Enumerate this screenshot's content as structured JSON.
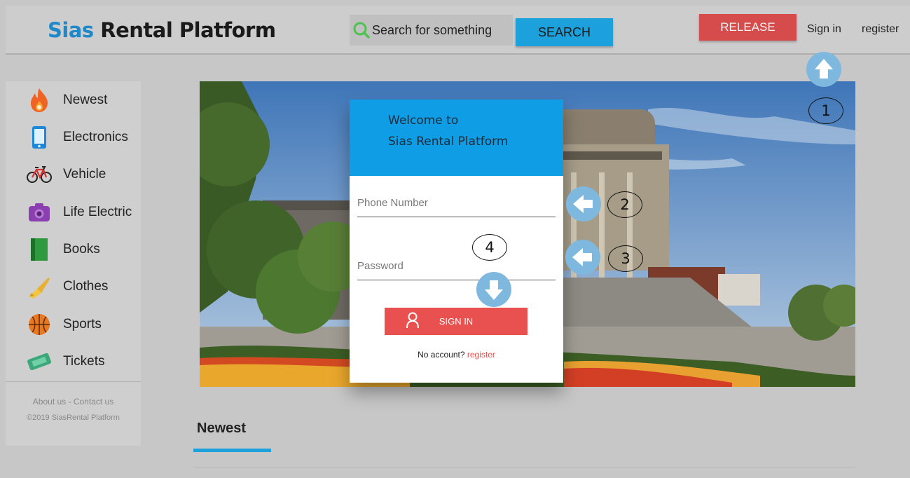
{
  "header": {
    "logo_brand": "Sias",
    "logo_rest": " Rental Platform",
    "search_placeholder": "Search for something",
    "search_button": "SEARCH",
    "release_button": "RELEASE",
    "signin_link": "Sign in",
    "register_link": "register"
  },
  "sidebar": {
    "items": [
      {
        "label": "Newest",
        "icon": "flame-icon"
      },
      {
        "label": "Electronics",
        "icon": "phone-icon"
      },
      {
        "label": "Vehicle",
        "icon": "bicycle-icon"
      },
      {
        "label": "Life Electric",
        "icon": "camera-icon"
      },
      {
        "label": "Books",
        "icon": "book-icon"
      },
      {
        "label": "Clothes",
        "icon": "clothes-brush-icon"
      },
      {
        "label": "Sports",
        "icon": "basketball-icon"
      },
      {
        "label": "Tickets",
        "icon": "ticket-icon"
      }
    ],
    "footer_links": "About us - Contact us",
    "copyright": "©2019 SiasRental Platform"
  },
  "login_modal": {
    "title_line1": "Welcome to",
    "title_line2": "Sias Rental Platform",
    "phone_placeholder": "Phone Number",
    "password_placeholder": "Password",
    "signin_button": "SIGN IN",
    "no_account_text": "No account?",
    "register_link": "register"
  },
  "main": {
    "section_title": "Newest"
  },
  "annotations": [
    "1",
    "2",
    "3",
    "4"
  ],
  "colors": {
    "accent_blue": "#1da1dc",
    "release_red": "#d64c4c",
    "signin_red": "#e8514f",
    "modal_header_blue": "#0f9ee6"
  }
}
